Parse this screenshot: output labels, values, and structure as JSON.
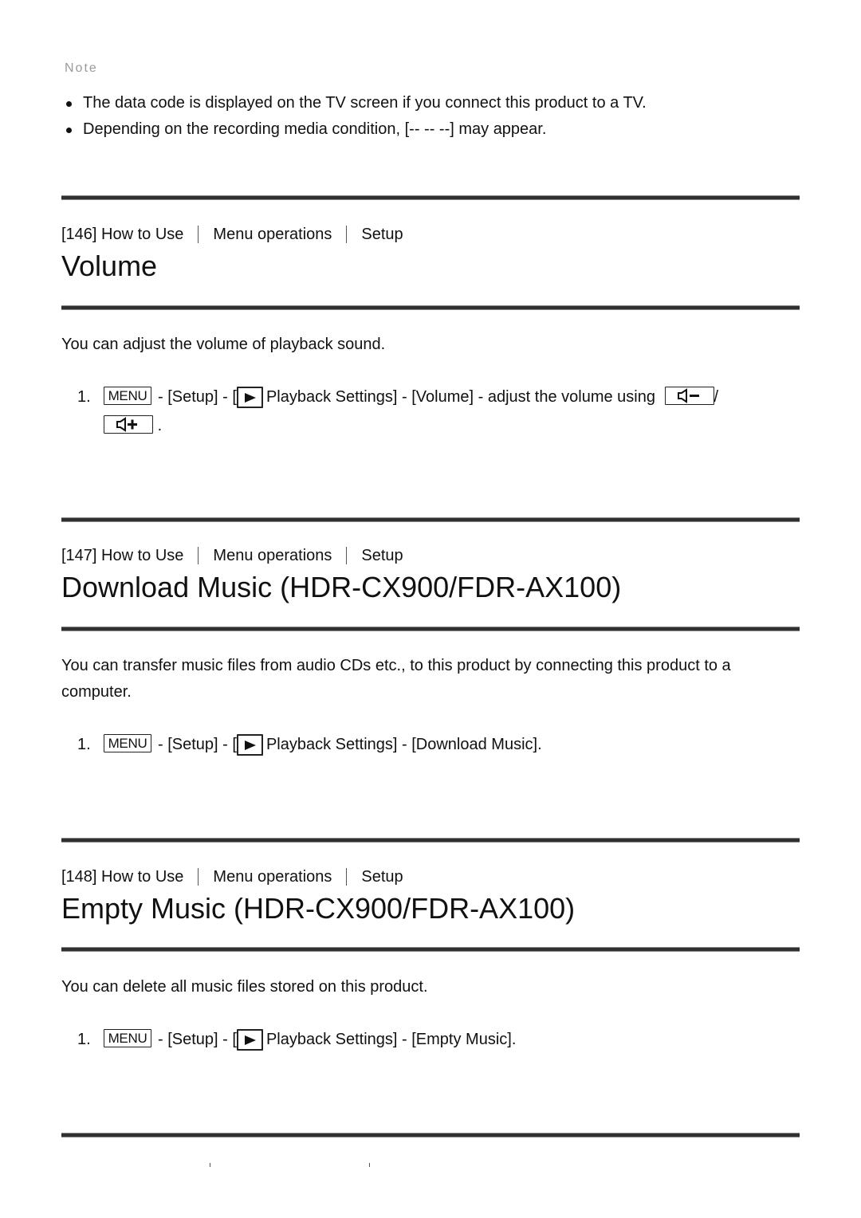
{
  "note": {
    "label": "Note",
    "items": [
      "The data code is displayed on the TV screen if you connect this product to a TV.",
      "Depending on the recording media condition, [-- -- --] may appear."
    ]
  },
  "sections": [
    {
      "number": "[146]",
      "breadcrumb": [
        "How to Use",
        "Menu operations",
        "Setup"
      ],
      "title": "Volume",
      "description": "You can adjust the volume of playback sound.",
      "step": {
        "num": "1.",
        "menu_label": "MENU",
        "part1": "- [Setup] - [",
        "part2": "Playback Settings] - [Volume] - adjust the volume using",
        "slash": "/",
        "end": "."
      }
    },
    {
      "number": "[147]",
      "breadcrumb": [
        "How to Use",
        "Menu operations",
        "Setup"
      ],
      "title": "Download Music (HDR-CX900/FDR-AX100)",
      "description": "You can transfer music files from audio CDs etc., to this product by connecting this product to a computer.",
      "step": {
        "num": "1.",
        "menu_label": "MENU",
        "part1": "- [Setup] - [",
        "part2": "Playback Settings] - [Download Music]."
      }
    },
    {
      "number": "[148]",
      "breadcrumb": [
        "How to Use",
        "Menu operations",
        "Setup"
      ],
      "title": "Empty Music (HDR-CX900/FDR-AX100)",
      "description": "You can delete all music files stored on this product.",
      "step": {
        "num": "1.",
        "menu_label": "MENU",
        "part1": "- [Setup] - [",
        "part2": "Playback Settings] - [Empty Music]."
      }
    }
  ],
  "icons": {
    "menu": "menu-button-icon",
    "playback": "playback-triangle-icon",
    "volume_down": "volume-down-icon",
    "volume_up": "volume-up-icon"
  },
  "colors": {
    "rule": "#303030",
    "note_label": "#9a9a9a",
    "text": "#111111"
  }
}
